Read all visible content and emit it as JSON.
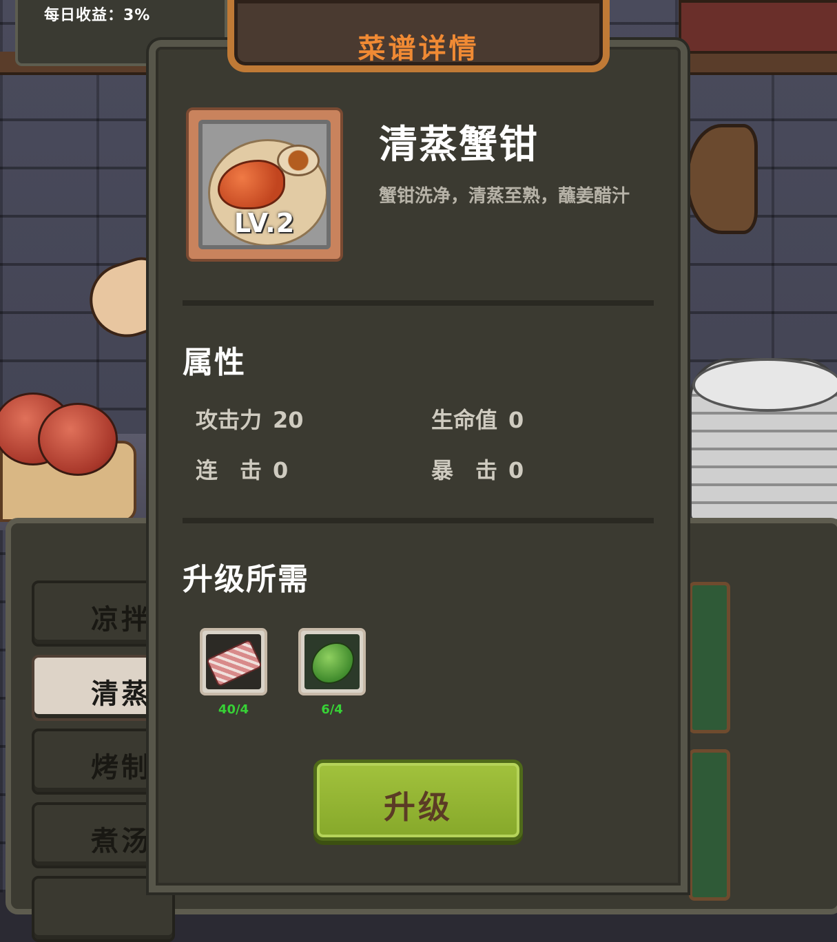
{
  "background": {
    "top_badge_text": "每日收益：3%",
    "categories": [
      {
        "label": "凉拌",
        "active": false
      },
      {
        "label": "清蒸",
        "active": true
      },
      {
        "label": "烤制",
        "active": false
      },
      {
        "label": "煮汤",
        "active": false
      }
    ]
  },
  "modal": {
    "title": "菜谱详情",
    "dish": {
      "name": "清蒸蟹钳",
      "level": "LV.2",
      "description": "蟹钳洗净，清蒸至熟，蘸姜醋汁",
      "icon": "crab-claw-dish-icon"
    },
    "attributes": {
      "section_title": "属性",
      "items": [
        {
          "label": "攻击力",
          "value": "20"
        },
        {
          "label": "生命值",
          "value": "0"
        },
        {
          "label": "连　击",
          "value": "0"
        },
        {
          "label": "暴　击",
          "value": "0"
        }
      ]
    },
    "requirements": {
      "section_title": "升级所需",
      "items": [
        {
          "icon": "meat-ingredient-icon",
          "count": "40/4"
        },
        {
          "icon": "green-vegetable-ingredient-icon",
          "count": "6/4"
        }
      ]
    },
    "upgrade_button": "升级"
  },
  "colors": {
    "title": "#f08a34",
    "sufficient": "#37d236",
    "button": "#98b833"
  }
}
